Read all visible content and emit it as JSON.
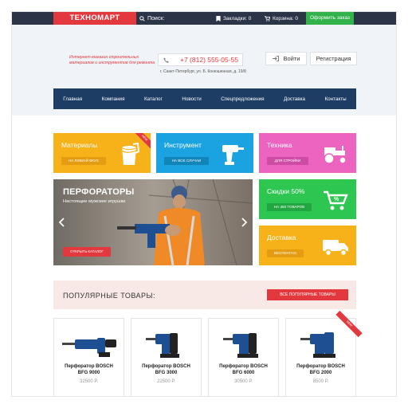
{
  "topbar": {
    "logo": "ТЕХНОМАРТ",
    "search": "Поиск:",
    "bookmarks": "Закладки: 0",
    "cart": "Корзина: 0",
    "order": "Оформить заказ"
  },
  "header": {
    "tagline": "Интернет-магазин строительных материалов и инструментов для ремонта",
    "phone": "+7 (812) 555-05-55",
    "address": "г. Санкт-Петербург, ул. Б. Конюшенная, д. 19/8",
    "login": "Войти",
    "register": "Регистрация"
  },
  "nav": [
    "Главная",
    "Компания",
    "Каталог",
    "Новости",
    "Спецпредложения",
    "Доставка",
    "Контакты"
  ],
  "tiles": {
    "materials": {
      "title": "Материалы",
      "button": "НА ЛЮБОЙ ВКУС",
      "ribbon": "NEW",
      "color": "#f7b21a"
    },
    "tools": {
      "title": "Инструмент",
      "button": "НА ВСЕ СЛУЧАИ",
      "color": "#1aa3e0"
    },
    "tech": {
      "title": "Техника",
      "button": "ДЛЯ СТРОЙКИ",
      "color": "#ec64c0"
    },
    "discounts": {
      "title": "Скидки 50%",
      "button": "НА 350 ТОВАРОВ",
      "color": "#2dc650"
    },
    "delivery": {
      "title": "Доставка",
      "button": "БЕСПЛАТНО",
      "color": "#f7b21a"
    }
  },
  "hero": {
    "title": "ПЕРФОРАТОРЫ",
    "subtitle": "Настоящие мужские игрушки",
    "button": "ОТКРЫТЬ КАТАЛОГ"
  },
  "popular": {
    "title": "ПОПУЛЯРНЫЕ ТОВАРЫ:",
    "button": "ВСЕ ПОПУЛЯРНЫЕ ТОВАРЫ"
  },
  "products": [
    {
      "name1": "Перфоратор BOSCH",
      "name2": "BFG 9000",
      "price": "32500 Р."
    },
    {
      "name1": "Перфоратор BOSCH",
      "name2": "BFG 3000",
      "price": "22500 Р."
    },
    {
      "name1": "Перфоратор BOSCH",
      "name2": "BFG 6000",
      "price": "30500 Р."
    },
    {
      "name1": "Перфоратор BOSCH",
      "name2": "BFG 2000",
      "price": "8500 Р.",
      "ribbon": "NEW"
    }
  ]
}
